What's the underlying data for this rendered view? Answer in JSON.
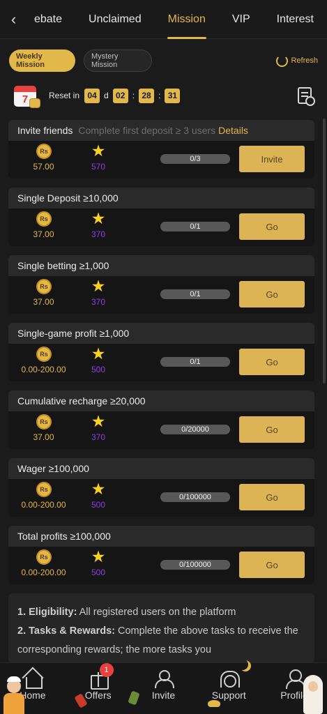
{
  "topbar": {
    "back_icon": "chevron-left-icon",
    "tabs": [
      {
        "label": "ebate"
      },
      {
        "label": "Unclaimed"
      },
      {
        "label": "Mission",
        "active": true
      },
      {
        "label": "VIP"
      },
      {
        "label": "Interest"
      }
    ]
  },
  "filters": {
    "weekly": "Weekly Mission",
    "mystery": "Mystery Mission",
    "refresh": "Refresh"
  },
  "reset": {
    "label": "Reset in",
    "days": "04",
    "d": "d",
    "hours": "02",
    "minutes": "28",
    "seconds": "31",
    "sep": ":",
    "calendar_number": "7"
  },
  "reward_symbol": "Rs",
  "star_glyph": "★",
  "missions": [
    {
      "title": "Invite friends",
      "subtitle": "Complete first deposit ≥ 3 users",
      "details": "Details",
      "reward": "57.00",
      "points": "570",
      "progress": "0/3",
      "action": "Invite"
    },
    {
      "title": "Single Deposit ≥10,000",
      "reward": "37.00",
      "points": "370",
      "progress": "0/1",
      "action": "Go"
    },
    {
      "title": "Single betting ≥1,000",
      "reward": "37.00",
      "points": "370",
      "progress": "0/1",
      "action": "Go"
    },
    {
      "title": "Single-game profit ≥1,000",
      "reward": "0.00-200.00",
      "points": "500",
      "progress": "0/1",
      "action": "Go"
    },
    {
      "title": "Cumulative recharge ≥20,000",
      "reward": "37.00",
      "points": "370",
      "progress": "0/20000",
      "action": "Go"
    },
    {
      "title": "Wager ≥100,000",
      "reward": "0.00-200.00",
      "points": "500",
      "progress": "0/100000",
      "action": "Go"
    },
    {
      "title": "Total profits ≥100,000",
      "reward": "0.00-200.00",
      "points": "500",
      "progress": "0/100000",
      "action": "Go"
    }
  ],
  "rules": {
    "r1_label": "1. Eligibility:",
    "r1_text": " All registered users on the platform",
    "r2_label": "2. Tasks & Rewards:",
    "r2_text": " Complete the above tasks to receive the corresponding rewards; the more tasks you"
  },
  "bottomnav": {
    "items": [
      {
        "label": "Home",
        "icon": "home-icon"
      },
      {
        "label": "Offers",
        "icon": "gift-icon",
        "badge": "1"
      },
      {
        "label": "Invite",
        "icon": "people-icon"
      },
      {
        "label": "Support",
        "icon": "headset-icon"
      },
      {
        "label": "Profile",
        "icon": "user-icon"
      }
    ]
  },
  "colors": {
    "accent": "#e3b84a",
    "points": "#8d3fe8",
    "badge": "#e8423f"
  }
}
